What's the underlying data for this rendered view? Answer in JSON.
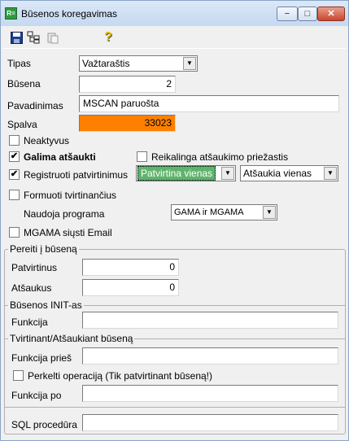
{
  "window": {
    "title": "Būsenos koregavimas",
    "minimize_glyph": "−",
    "maximize_glyph": "□",
    "close_glyph": "✕"
  },
  "toolbar": {
    "icons": [
      "save-icon",
      "copy-tree-icon",
      "paste-icon",
      "help-icon"
    ],
    "help_glyph": "?"
  },
  "form": {
    "tipas_label": "Tipas",
    "tipas_value": "Važtaraštis",
    "busena_label": "Būsena",
    "busena_value": "2",
    "pavadinimas_label": "Pavadinimas",
    "pavadinimas_value": "MSCAN paruošta",
    "spalva_label": "Spalva",
    "spalva_value": "33023",
    "spalva_color": "#ff8000",
    "neaktyvus_label": "Neaktyvus",
    "neaktyvus_checked": false,
    "galima_atsaukti_label": "Galima atšaukti",
    "galima_atsaukti_checked": true,
    "reikalinga_label": "Reikalinga atšaukimo priežastis",
    "reikalinga_checked": false,
    "registruoti_label": "Registruoti patvirtinimus",
    "registruoti_checked": true,
    "patvirtina_value": "Patvirtina vienas",
    "patvirtina_color": "#5fb36d",
    "atsaukia_value": "Atšaukia vienas",
    "formuoti_label": "Formuoti tvirtinančius",
    "formuoti_checked": false,
    "naudoja_label": "Naudoja programa",
    "naudoja_value": "GAMA ir MGAMA",
    "mgama_label": "MGAMA siųsti Email",
    "mgama_checked": false
  },
  "pereiti": {
    "title": "Pereiti į būseną",
    "patvirtinus_label": "Patvirtinus",
    "patvirtinus_value": "0",
    "atsaukus_label": "Atšaukus",
    "atsaukus_value": "0"
  },
  "init": {
    "title": "Būsenos INIT-as",
    "funkcija_label": "Funkcija",
    "funkcija_value": ""
  },
  "tvirtinant": {
    "title": "Tvirtinant/Atšaukiant būseną",
    "funkcija_pries_label": "Funkcija prieš",
    "funkcija_pries_value": "",
    "perkelti_label": "Perkelti operaciją (Tik patvirtinant būseną!)",
    "perkelti_checked": false,
    "funkcija_po_label": "Funkcija po",
    "funkcija_po_value": ""
  },
  "sql": {
    "label": "SQL procedūra",
    "value": ""
  }
}
